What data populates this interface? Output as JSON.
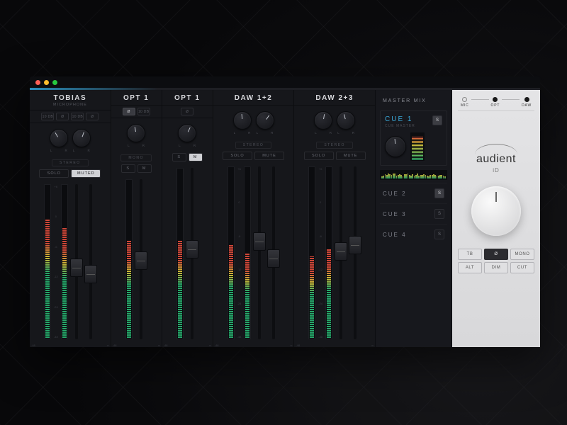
{
  "channels": [
    {
      "title": "TOBIAS",
      "sub": "MICROPHONE",
      "wide": true,
      "dual": true,
      "pills": [
        {
          "t": "10 DB",
          "on": false
        },
        {
          "t": "Ø",
          "on": false
        },
        {
          "t": "10 DB",
          "on": false
        },
        {
          "t": "Ø",
          "on": false
        }
      ],
      "knob_r": [
        -30,
        20
      ],
      "mode": "STEREO",
      "sm": [
        {
          "t": "SOLO",
          "on": false
        },
        {
          "t": "MUTED",
          "on": true
        }
      ],
      "meters": [
        78,
        72
      ],
      "fader_t": [
        48,
        52
      ]
    },
    {
      "title": "OPT 1",
      "wide": false,
      "dual": false,
      "pills": [
        {
          "t": "Ø",
          "on": true
        },
        {
          "t": "10 DB",
          "on": false
        }
      ],
      "knob_r": [
        -10
      ],
      "mode": "MONO",
      "sm": [
        {
          "t": "S",
          "on": false
        },
        {
          "t": "M",
          "on": false
        }
      ],
      "meters": [
        62
      ],
      "fader_t": [
        45
      ]
    },
    {
      "title": "OPT 1",
      "wide": false,
      "dual": false,
      "pills": [
        {
          "t": "Ø",
          "on": false
        }
      ],
      "knob_r": [
        25
      ],
      "mode": "",
      "sm": [
        {
          "t": "S",
          "on": false
        },
        {
          "t": "M",
          "on": true
        }
      ],
      "meters": [
        58
      ],
      "fader_t": [
        42
      ]
    },
    {
      "title": "DAW 1+2",
      "wide": true,
      "dual": true,
      "pills": [],
      "knob_r": [
        -5,
        35
      ],
      "mode": "STEREO",
      "sm": [
        {
          "t": "SOLO",
          "on": false
        },
        {
          "t": "MUTE",
          "on": false
        }
      ],
      "meters": [
        55,
        50
      ],
      "fader_t": [
        38,
        48
      ]
    },
    {
      "title": "DAW 2+3",
      "wide": true,
      "dual": true,
      "pills": [],
      "knob_r": [
        10,
        -15
      ],
      "mode": "STEREO",
      "sm": [
        {
          "t": "SOLO",
          "on": false
        },
        {
          "t": "MUTE",
          "on": false
        }
      ],
      "meters": [
        48,
        52
      ],
      "fader_t": [
        44,
        40
      ]
    }
  ],
  "master": {
    "title": "MASTER MIX",
    "cue1": {
      "title": "CUE 1",
      "sub": "CUE MASTER",
      "solo_on": true,
      "knob_r": -5,
      "meter": 85
    },
    "cues": [
      {
        "label": "CUE 2",
        "on": true
      },
      {
        "label": "CUE 3",
        "on": false
      },
      {
        "label": "CUE 4",
        "on": false
      }
    ],
    "spectrum": [
      30,
      45,
      60,
      55,
      70,
      65,
      50,
      72,
      68,
      40,
      55,
      62,
      48,
      35,
      58,
      64,
      70,
      52,
      44,
      60,
      38,
      50,
      66,
      42,
      55,
      48,
      60,
      52,
      40,
      35,
      48,
      55,
      62,
      50,
      44,
      38,
      52,
      46,
      40,
      35
    ]
  },
  "hw": {
    "sources": [
      {
        "label": "MIC",
        "on": false
      },
      {
        "label": "OPT",
        "on": true
      },
      {
        "label": "DAW",
        "on": true
      }
    ],
    "logo": "audient",
    "logo_sub": "iD",
    "buttons": [
      {
        "t": "TB",
        "on": false
      },
      {
        "t": "Ø",
        "on": true
      },
      {
        "t": "MONO",
        "on": false
      },
      {
        "t": "ALT",
        "on": false
      },
      {
        "t": "DIM",
        "on": false
      },
      {
        "t": "CUT",
        "on": false
      }
    ]
  },
  "knob_lr": {
    "l": "L",
    "r": "R"
  },
  "fader_scale": [
    "+6",
    "0",
    "-6",
    "-12",
    "-24",
    "-48"
  ],
  "fader_bottom": {
    "l": "-48",
    "r": "∞"
  },
  "s_label": "S"
}
